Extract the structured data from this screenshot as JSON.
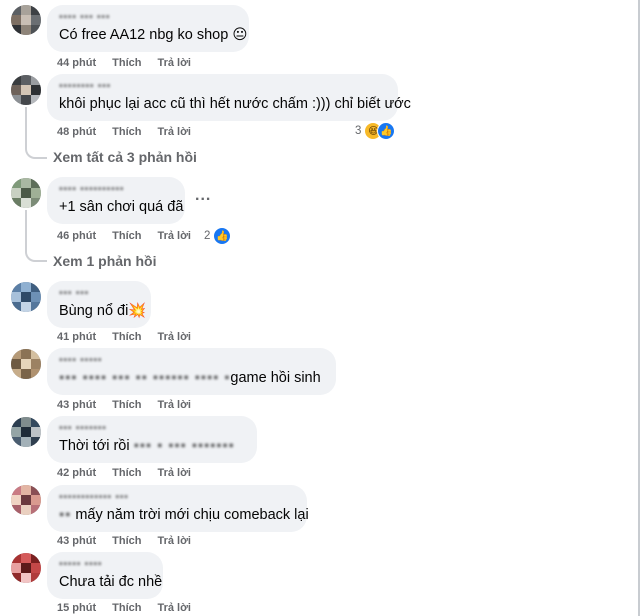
{
  "comments": [
    {
      "name": "▪▪▪▪ ▪▪▪ ▪▪▪",
      "text_plain": "Có free AA12 nbg ko shop",
      "text_emoji": "😐",
      "text_blur": "",
      "time": "44 phút",
      "like_label": "Thích",
      "reply_label": "Trả lời"
    },
    {
      "name": "▪▪▪▪▪▪▪▪ ▪▪▪",
      "text_plain": "khôi phục lại acc cũ thì hết nước chấm :))) chỉ biết ước",
      "time": "48 phút",
      "like_label": "Thích",
      "reply_label": "Trả lời",
      "reaction_count": "3",
      "reaction_icons": [
        "haha-icon",
        "like-icon"
      ],
      "replies_link": "Xem tất cả 3 phản hồi"
    },
    {
      "name": "▪▪▪▪ ▪▪▪▪▪▪▪▪▪▪",
      "text_plain": "+1 sân chơi quá đã",
      "time": "46 phút",
      "like_label": "Thích",
      "reply_label": "Trả lời",
      "reaction_count": "2",
      "reaction_icons": [
        "like-icon"
      ],
      "more": "...",
      "replies_link": "Xem 1 phản hồi"
    },
    {
      "name": "▪▪▪ ▪▪▪",
      "text_plain": "Bùng nổ đi",
      "text_emoji": "💥",
      "time": "41 phút",
      "like_label": "Thích",
      "reply_label": "Trả lời"
    },
    {
      "name": "▪▪▪▪ ▪▪▪▪▪",
      "text_blur": "▪▪▪ ▪▪▪▪ ▪▪▪ ▪▪ ▪▪▪▪▪▪ ▪▪▪▪ ▪",
      "text_plain": "game hồi sinh",
      "time": "43 phút",
      "like_label": "Thích",
      "reply_label": "Trả lời"
    },
    {
      "name": "▪▪▪ ▪▪▪▪▪▪▪",
      "text_plain": "Thời tới rồi",
      "text_blur_after": "▪▪▪ ▪ ▪▪▪ ▪▪▪▪▪▪▪",
      "time": "42 phút",
      "like_label": "Thích",
      "reply_label": "Trả lời"
    },
    {
      "name": "▪▪▪▪▪▪▪▪▪▪▪▪ ▪▪▪",
      "text_blur": "▪▪",
      "text_plain": "mấy năm trời mới chịu comeback lại",
      "time": "43 phút",
      "like_label": "Thích",
      "reply_label": "Trả lời"
    },
    {
      "name": "▪▪▪▪▪ ▪▪▪▪",
      "text_plain": "Chưa tải đc nhề",
      "time": "15 phút",
      "like_label": "Thích",
      "reply_label": "Trả lời"
    }
  ],
  "colors": {
    "bubble": "#f0f2f5",
    "meta_text": "#65676b",
    "like_blue": "#1877f2",
    "haha_yellow": "#f7b928"
  }
}
